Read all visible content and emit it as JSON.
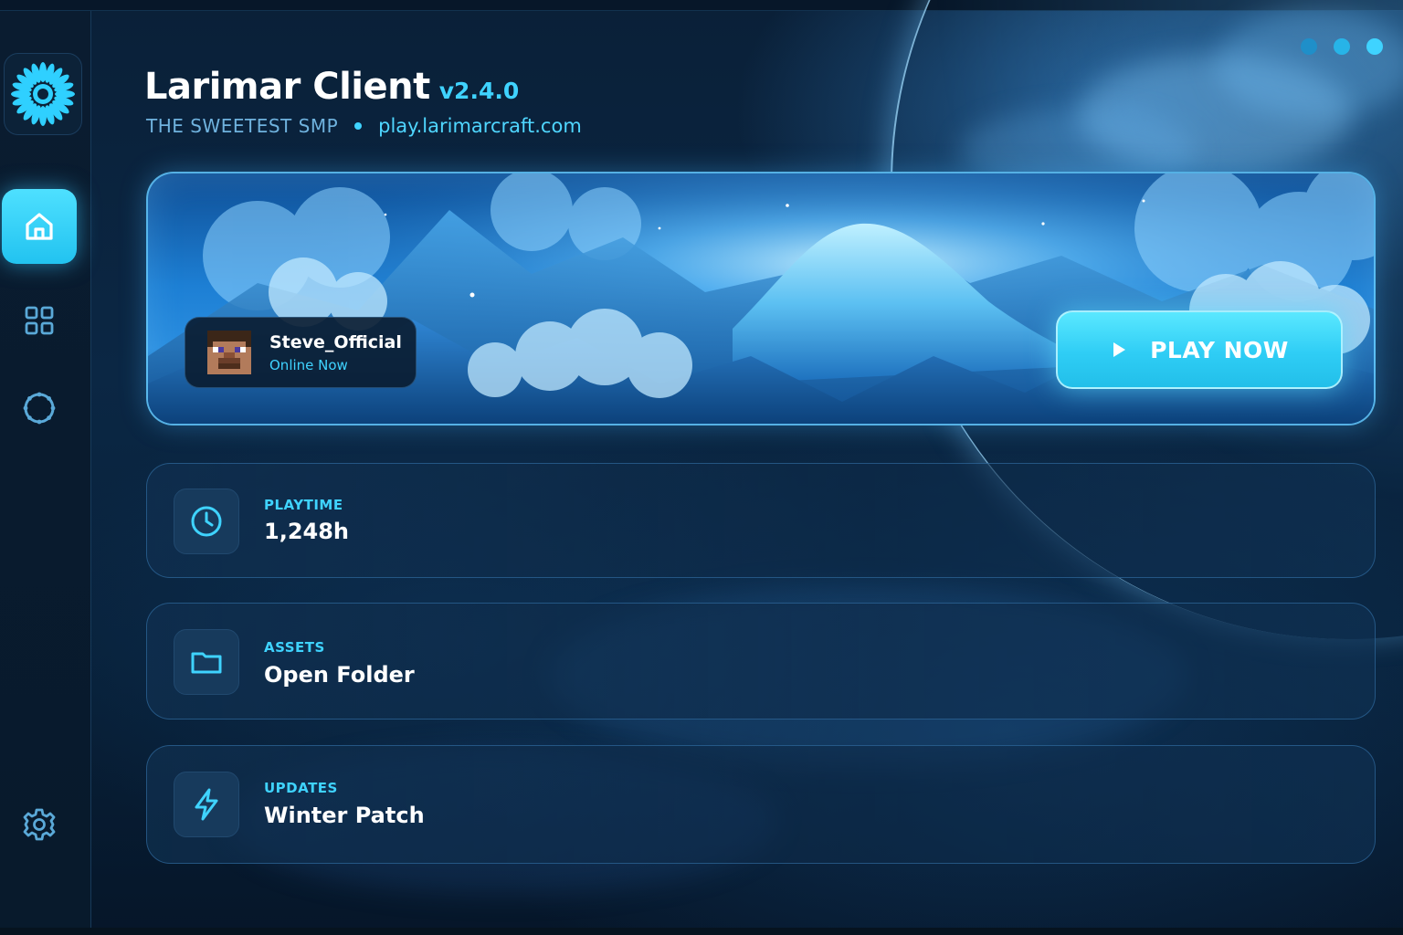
{
  "app": {
    "title": "Larimar Client",
    "version": "v2.4.0",
    "tagline": "THE SWEETEST SMP",
    "server": "play.larimarcraft.com"
  },
  "sidebar": {
    "items": [
      {
        "name": "home",
        "icon": "home-icon",
        "active": true
      },
      {
        "name": "grid",
        "icon": "grid-icon",
        "active": false
      },
      {
        "name": "globe",
        "icon": "globe-icon",
        "active": false
      },
      {
        "name": "settings",
        "icon": "gear-icon",
        "active": false
      }
    ]
  },
  "window_controls": [
    "minimize",
    "maximize",
    "close"
  ],
  "banner": {
    "user": {
      "name": "Steve_Official",
      "status": "Online Now"
    },
    "play_label": "PLAY NOW"
  },
  "cards": [
    {
      "label": "PLAYTIME",
      "value": "1,248h",
      "icon": "clock-icon"
    },
    {
      "label": "ASSETS",
      "value": "Open Folder",
      "icon": "folder-icon"
    },
    {
      "label": "UPDATES",
      "value": "Winter Patch",
      "icon": "lightning-icon"
    }
  ],
  "colors": {
    "accent": "#3fd3ff",
    "background": "#0b2744",
    "sidebar": "#0a1c30"
  }
}
